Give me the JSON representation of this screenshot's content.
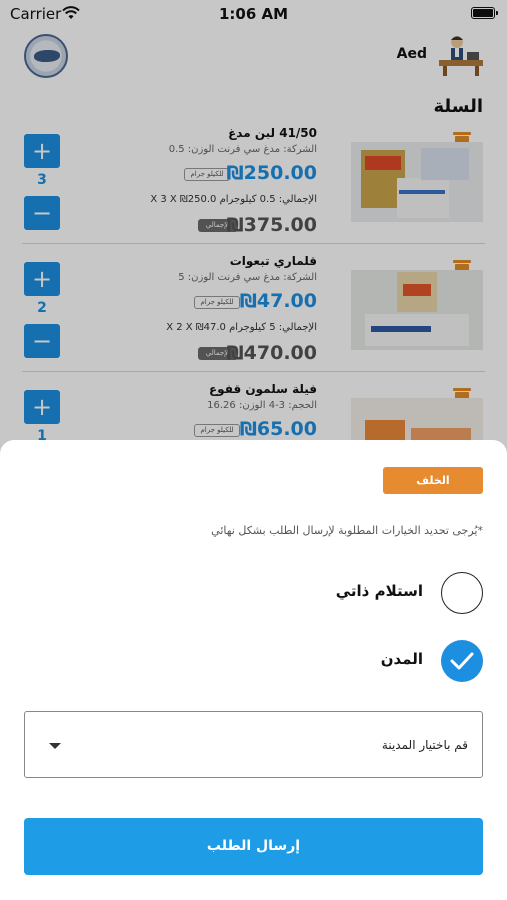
{
  "status_bar": {
    "carrier": "Carrier",
    "time": "1:06 AM"
  },
  "header": {
    "user_name": "Aed"
  },
  "cart": {
    "title": "السلة",
    "items": [
      {
        "name": "41/50 لبن مدغ",
        "meta": "الشركة: مدغ سي فرنت   الوزن: 0.5",
        "unit": "للكيلو جرام",
        "price": "₪250.00",
        "total_line": "الإجمالي: 0.5 كيلوجرام  X  3 X  ₪250.0",
        "total_label": "الإجمالي",
        "total": "₪375.00",
        "quantity": "3",
        "plus": "+",
        "minus": "−"
      },
      {
        "name": "قلماري تبعوات",
        "meta": "الشركة: مدغ سي فرنت   الوزن: 5",
        "unit": "للكيلو جرام",
        "price": "₪47.00",
        "total_line": "الإجمالي: 5 كيلوجرام  X  2 X  ₪47.0",
        "total_label": "الإجمالي",
        "total": "₪470.00",
        "quantity": "2",
        "plus": "+",
        "minus": "−"
      },
      {
        "name": "فيلة سلمون قفوع",
        "meta": "الحجم: 3-4   الوزن: 16.26",
        "unit": "للكيلو جرام",
        "price": "₪65.00",
        "quantity": "1",
        "plus": "+"
      }
    ]
  },
  "sheet": {
    "back_label": "الخلف",
    "hint": "*يُرجى تحديد الخيارات المطلوبة لإرسال الطلب بشكل نهائي",
    "options": [
      {
        "label": "استلام ذاتي",
        "checked": false
      },
      {
        "label": "المدن",
        "checked": true
      }
    ],
    "city_placeholder": "قم باختيار المدينة",
    "submit_label": "إرسال الطلب"
  },
  "colors": {
    "accent_blue": "#1d8fe0",
    "accent_orange": "#e68b2f"
  }
}
